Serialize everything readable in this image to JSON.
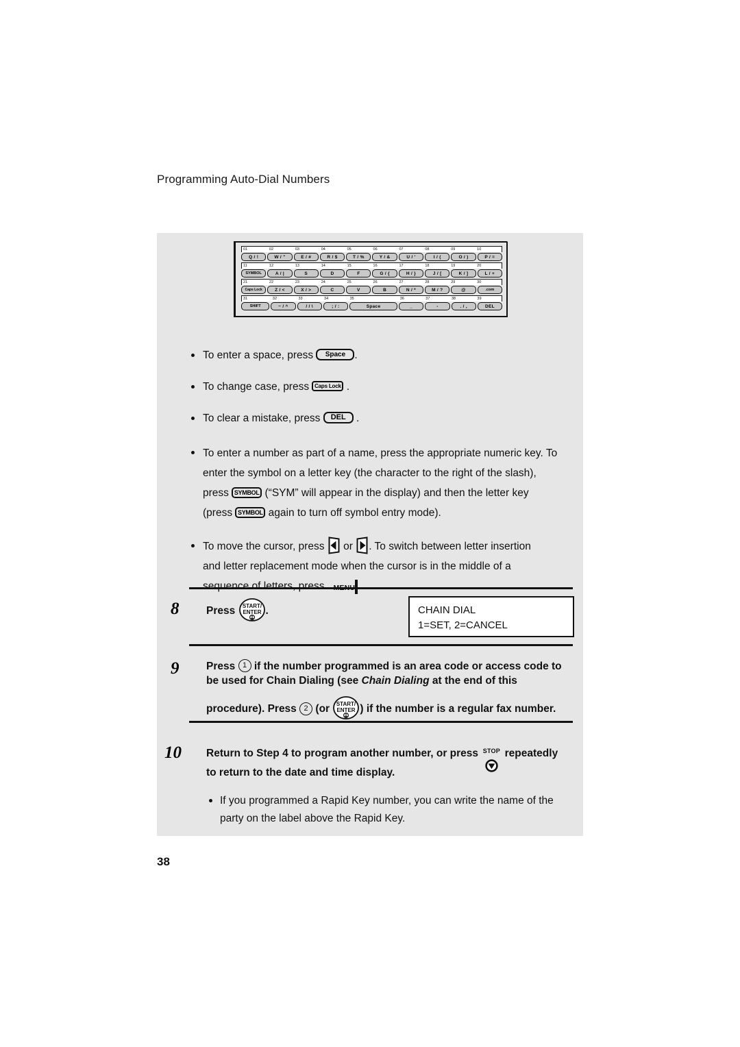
{
  "page": {
    "header": "Programming Auto-Dial Numbers",
    "number": "38"
  },
  "keyboard_diagram": {
    "rows": [
      {
        "numbers": [
          "01",
          "02",
          "03",
          "04",
          "05",
          "06",
          "07",
          "08",
          "09",
          "10"
        ],
        "keys": [
          "Q / !",
          "W / \"",
          "E / #",
          "R / $",
          "T / %",
          "Y / &",
          "U / '",
          "I / (",
          "O / )",
          "P / ="
        ]
      },
      {
        "numbers": [
          "11",
          "12",
          "13",
          "14",
          "15",
          "16",
          "17",
          "18",
          "19",
          "20"
        ],
        "keys": [
          "SYMBOL",
          "A / |",
          "S",
          "D",
          "F",
          "G / {",
          "H / }",
          "J / [",
          "K / ]",
          "L / +"
        ]
      },
      {
        "numbers": [
          "21",
          "22",
          "23",
          "24",
          "25",
          "26",
          "27",
          "28",
          "29",
          "30"
        ],
        "keys": [
          "Caps Lock",
          "Z / <",
          "X / >",
          "C",
          "V",
          "B",
          "N / *",
          "M / ?",
          "@",
          ".com"
        ]
      },
      {
        "numbers": [
          "31",
          "32",
          "33",
          "34",
          "35",
          "36",
          "37",
          "38",
          "39"
        ],
        "keys": [
          "SHIFT",
          "~ / ^",
          "/ / \\",
          ";  /  :",
          "Space",
          "_",
          "-",
          ". / ,",
          "DEL"
        ]
      }
    ]
  },
  "bullets": [
    {
      "id": "space-bullet",
      "pre": "To enter a space, press ",
      "key": "Space",
      "post": "."
    },
    {
      "id": "caps-bullet",
      "pre": "To change case, press ",
      "key": "Caps Lock",
      "post": " ."
    },
    {
      "id": "del-bullet",
      "pre": "To clear a mistake, press ",
      "key": "DEL",
      "post": " ."
    }
  ],
  "symbol_bullet": {
    "line1": "To enter a number as part of a name, press the appropriate numeric key. To",
    "line2": "enter the symbol on a letter key (the character to the right of the slash),",
    "line3_pre": "press ",
    "key1": "SYMBOL",
    "line3_post": " (“SYM” will appear in the display) and then the letter key",
    "line4_pre": "(press ",
    "key2": "SYMBOL",
    "line4_post": " again to turn off symbol entry mode)."
  },
  "cursor_bullet": {
    "line1_pre": "To move the cursor, press ",
    "arrow_left": "left-arrow",
    "line1_mid": " or ",
    "arrow_right": "right-arrow",
    "line1_post": ". To switch between letter insertion",
    "line2": "and letter replacement mode when the cursor is in the middle of a",
    "line3_pre": "sequence of letters, press ",
    "menu_key": "MENU",
    "line3_post": "."
  },
  "steps": [
    {
      "num": "8",
      "pre": "Press ",
      "key": "START/ ENTER",
      "post": ".",
      "lcd": {
        "line1": "CHAIN DIAL",
        "line2": "1=SET, 2=CANCEL"
      }
    },
    {
      "num": "9",
      "pre": "Press ",
      "key1": "1",
      "mid1": " if the number programmed is an area code or access code to",
      "line2a": "be used for Chain Dialing (see ",
      "line2_italic": "Chain Dialing",
      "line2b": " at the end of this",
      "line3a": "procedure). Press ",
      "key2": "2",
      "line3b": " (or ",
      "key3": "START/ENTER",
      "line3c": ") if the number is a regular fax number."
    },
    {
      "num": "10",
      "line1a": "Return to Step 4 to program another number, or press ",
      "key": "STOP",
      "line1b": " repeatedly",
      "line2": "to return to the date and time display.",
      "subbullet": {
        "line1": "If you programmed a Rapid Key number, you can write the name of the",
        "line2": "party on the label above the Rapid Key."
      }
    }
  ],
  "colors": {
    "panel_bg": "#e6e6e6",
    "key_fill": "#c9c9c9",
    "ink": "#111111"
  }
}
